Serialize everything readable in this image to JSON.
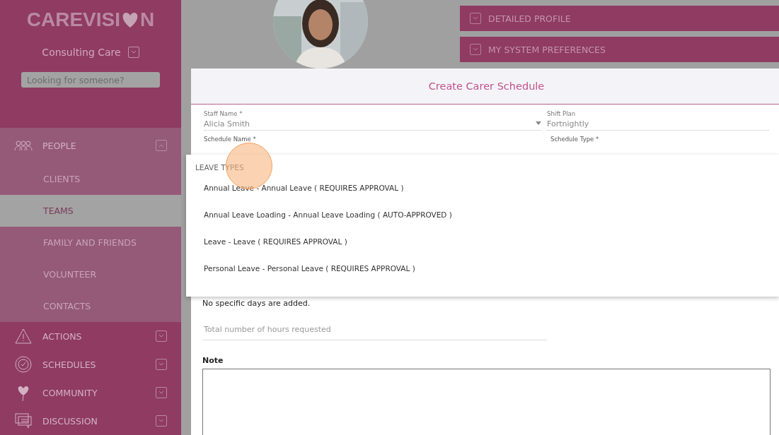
{
  "sidebar": {
    "logo": {
      "before": "CAREVISI",
      "after": "N"
    },
    "organization": "Consulting Care",
    "search": {
      "placeholder": "Looking for someone?"
    },
    "nav": [
      {
        "label": "PEOPLE",
        "expanded": true,
        "children": [
          {
            "label": "CLIENTS",
            "selected": false
          },
          {
            "label": "TEAMS",
            "selected": true
          },
          {
            "label": "FAMILY AND FRIENDS",
            "selected": false
          },
          {
            "label": "VOLUNTEER",
            "selected": false
          },
          {
            "label": "CONTACTS",
            "selected": false
          }
        ]
      },
      {
        "label": "ACTIONS",
        "expanded": false
      },
      {
        "label": "SCHEDULES",
        "expanded": false
      },
      {
        "label": "COMMUNITY",
        "expanded": false
      },
      {
        "label": "DISCUSSION",
        "expanded": false
      }
    ]
  },
  "profile": {
    "sections": [
      {
        "label": "DETAILED PROFILE",
        "expanded": false
      },
      {
        "label": "MY SYSTEM PREFERENCES",
        "expanded": false
      }
    ]
  },
  "modal": {
    "title": "Create Carer Schedule",
    "fields": [
      {
        "label": "Staff Name *",
        "value": "Alicia Smith",
        "kind": "select"
      },
      {
        "label": "Shift Plan",
        "value": "Fortnightly",
        "kind": "text"
      }
    ],
    "partial_labels": [
      "Schedule Name *",
      "Schedule Type *"
    ],
    "dropdown": {
      "heading": "LEAVE TYPES",
      "options": [
        {
          "label": "Annual Leave - Annual Leave ( REQUIRES APPROVAL )",
          "selected": false
        },
        {
          "label": "Annual Leave Loading - Annual Leave Loading ( AUTO-APPROVED )",
          "selected": false
        },
        {
          "label": "Leave - Leave ( REQUIRES APPROVAL )",
          "selected": false
        },
        {
          "label": "Personal Leave - Personal Leave ( REQUIRES APPROVAL )",
          "selected": false
        }
      ]
    },
    "days_message": "No specific days are added.",
    "hours": {
      "placeholder": "Total number of hours requested"
    },
    "note": {
      "label": "Note"
    }
  }
}
